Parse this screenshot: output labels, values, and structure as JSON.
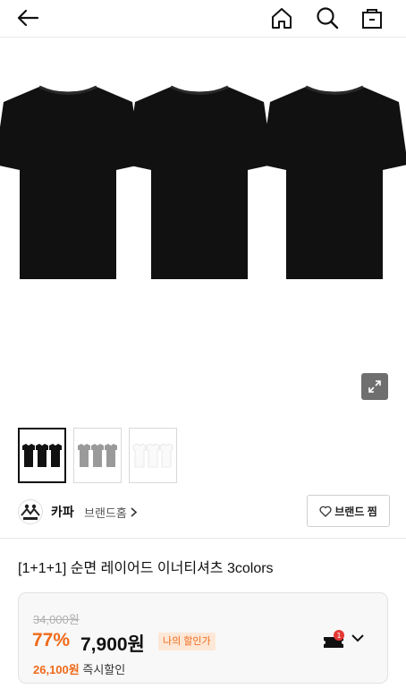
{
  "header": {
    "back_icon": "arrow-left-icon",
    "home_icon": "home-icon",
    "search_icon": "search-icon",
    "bag_icon": "shopping-bag-icon"
  },
  "gallery": {
    "expand_icon": "expand-icon",
    "thumbnails": [
      "black",
      "gray",
      "white"
    ]
  },
  "brand": {
    "name": "카파",
    "home_link": "브랜드홈",
    "follow_label": "브랜드 찜"
  },
  "product": {
    "title": "[1+1+1] 순면 레이어드 이너티셔츠 3colors"
  },
  "price": {
    "original": "34,000원",
    "discount_rate": "77%",
    "sale": "7,900원",
    "my_price_badge": "나의 할인가",
    "saved_amount": "26,100원",
    "saved_label": "즉시할인",
    "coupon_count": "1"
  },
  "colors": {
    "accent": "#ef6a1a",
    "badge_bg": "#fde7d6",
    "coupon_dot": "#e53935"
  }
}
